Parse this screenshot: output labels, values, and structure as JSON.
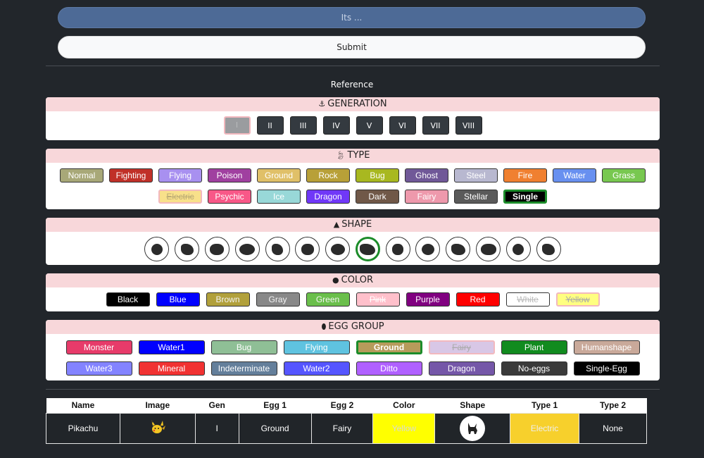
{
  "guess_placeholder": "Its ...",
  "submit_label": "Submit",
  "reference_title": "Reference",
  "generation": {
    "title": "GENERATION",
    "items": [
      "I",
      "II",
      "III",
      "IV",
      "V",
      "VI",
      "VII",
      "VIII"
    ]
  },
  "type": {
    "title": "TYPE",
    "row1": [
      {
        "label": "Normal",
        "color": "#a8a878"
      },
      {
        "label": "Fighting",
        "color": "#c03028"
      },
      {
        "label": "Flying",
        "color": "#a890f0"
      },
      {
        "label": "Poison",
        "color": "#a040a0"
      },
      {
        "label": "Ground",
        "color": "#e0c068"
      },
      {
        "label": "Rock",
        "color": "#b8a038"
      },
      {
        "label": "Bug",
        "color": "#a8b820"
      },
      {
        "label": "Ghost",
        "color": "#705898"
      },
      {
        "label": "Steel",
        "color": "#b8b8d0"
      },
      {
        "label": "Fire",
        "color": "#f08030"
      },
      {
        "label": "Water",
        "color": "#6890f0"
      },
      {
        "label": "Grass",
        "color": "#78c850"
      }
    ],
    "row2": [
      {
        "label": "Electric",
        "color": "#f8e08a"
      },
      {
        "label": "Psychic",
        "color": "#f85888"
      },
      {
        "label": "Ice",
        "color": "#98d8d8"
      },
      {
        "label": "Dragon",
        "color": "#7038f8"
      },
      {
        "label": "Dark",
        "color": "#705848"
      },
      {
        "label": "Fairy",
        "color": "#ee99ac"
      },
      {
        "label": "Stellar",
        "color": "#5a5a5a"
      },
      {
        "label": "Single",
        "color": "#000000"
      }
    ]
  },
  "shape": {
    "title": "SHAPE",
    "count": 14,
    "selected_index": 7
  },
  "color": {
    "title": "COLOR",
    "items": [
      {
        "label": "Black",
        "color": "#000000"
      },
      {
        "label": "Blue",
        "color": "#0000ff"
      },
      {
        "label": "Brown",
        "color": "#b1a03b"
      },
      {
        "label": "Gray",
        "color": "#888888"
      },
      {
        "label": "Green",
        "color": "#6abf4b"
      },
      {
        "label": "Pink",
        "color": "#ffc0cb"
      },
      {
        "label": "Purple",
        "color": "#800080"
      },
      {
        "label": "Red",
        "color": "#ff0000"
      },
      {
        "label": "White",
        "color": "#ffffff"
      },
      {
        "label": "Yellow",
        "color": "#ffff80"
      }
    ]
  },
  "egg": {
    "title": "EGG GROUP",
    "row1": [
      {
        "label": "Monster",
        "color": "#e73b6a"
      },
      {
        "label": "Water1",
        "color": "#0000ff"
      },
      {
        "label": "Bug",
        "color": "#8fbf96"
      },
      {
        "label": "Flying",
        "color": "#5fc3e0"
      },
      {
        "label": "Ground",
        "color": "#b69b5b"
      },
      {
        "label": "Fairy",
        "color": "#d8c7e6"
      },
      {
        "label": "Plant",
        "color": "#118b1f"
      },
      {
        "label": "Humanshape",
        "color": "#c9a99a"
      }
    ],
    "row2": [
      {
        "label": "Water3",
        "color": "#8383ff"
      },
      {
        "label": "Mineral",
        "color": "#f13232"
      },
      {
        "label": "Indeterminate",
        "color": "#647f9b"
      },
      {
        "label": "Water2",
        "color": "#5555ff"
      },
      {
        "label": "Ditto",
        "color": "#b060ff"
      },
      {
        "label": "Dragon",
        "color": "#7557a8"
      },
      {
        "label": "No-eggs",
        "color": "#3a3a3a"
      },
      {
        "label": "Single-Egg",
        "color": "#000000"
      }
    ]
  },
  "table": {
    "headers": [
      "Name",
      "Image",
      "Gen",
      "Egg 1",
      "Egg 2",
      "Color",
      "Shape",
      "Type 1",
      "Type 2"
    ],
    "row": {
      "name": "Pikachu",
      "gen": "I",
      "egg1": "Ground",
      "egg2": "Fairy",
      "color": "Yellow",
      "type1": "Electric",
      "type2": "None",
      "color_bg": "#ffff00",
      "type1_bg": "#f7d02c"
    }
  }
}
